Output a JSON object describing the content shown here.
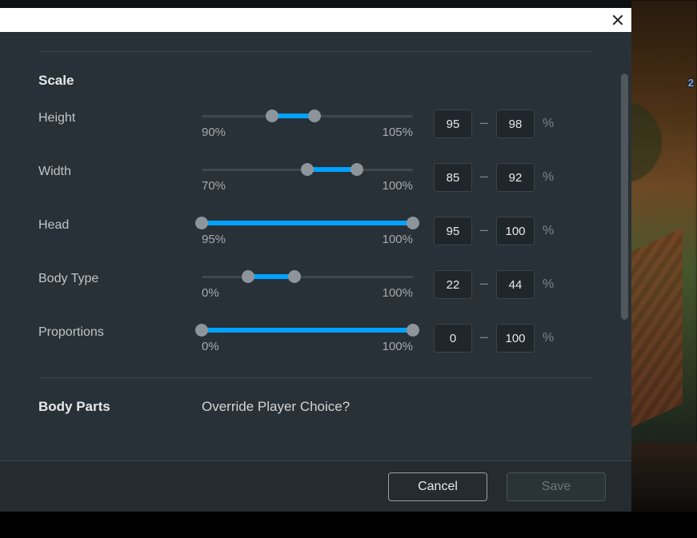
{
  "distance_marker": "2",
  "scale": {
    "title": "Scale",
    "unit": "%",
    "sliders": [
      {
        "id": "height",
        "label": "Height",
        "rail_min": 90,
        "rail_max": 105,
        "min_label": "90%",
        "max_label": "105%",
        "lo": 95,
        "hi": 98
      },
      {
        "id": "width",
        "label": "Width",
        "rail_min": 70,
        "rail_max": 100,
        "min_label": "70%",
        "max_label": "100%",
        "lo": 85,
        "hi": 92
      },
      {
        "id": "head",
        "label": "Head",
        "rail_min": 95,
        "rail_max": 100,
        "min_label": "95%",
        "max_label": "100%",
        "lo": 95,
        "hi": 100
      },
      {
        "id": "bodytype",
        "label": "Body Type",
        "rail_min": 0,
        "rail_max": 100,
        "min_label": "0%",
        "max_label": "100%",
        "lo": 22,
        "hi": 44
      },
      {
        "id": "proportions",
        "label": "Proportions",
        "rail_min": 0,
        "rail_max": 100,
        "min_label": "0%",
        "max_label": "100%",
        "lo": 0,
        "hi": 100
      }
    ]
  },
  "body_parts": {
    "title": "Body Parts",
    "override_question": "Override Player Choice?"
  },
  "footer": {
    "cancel": "Cancel",
    "save": "Save",
    "save_enabled": false
  }
}
